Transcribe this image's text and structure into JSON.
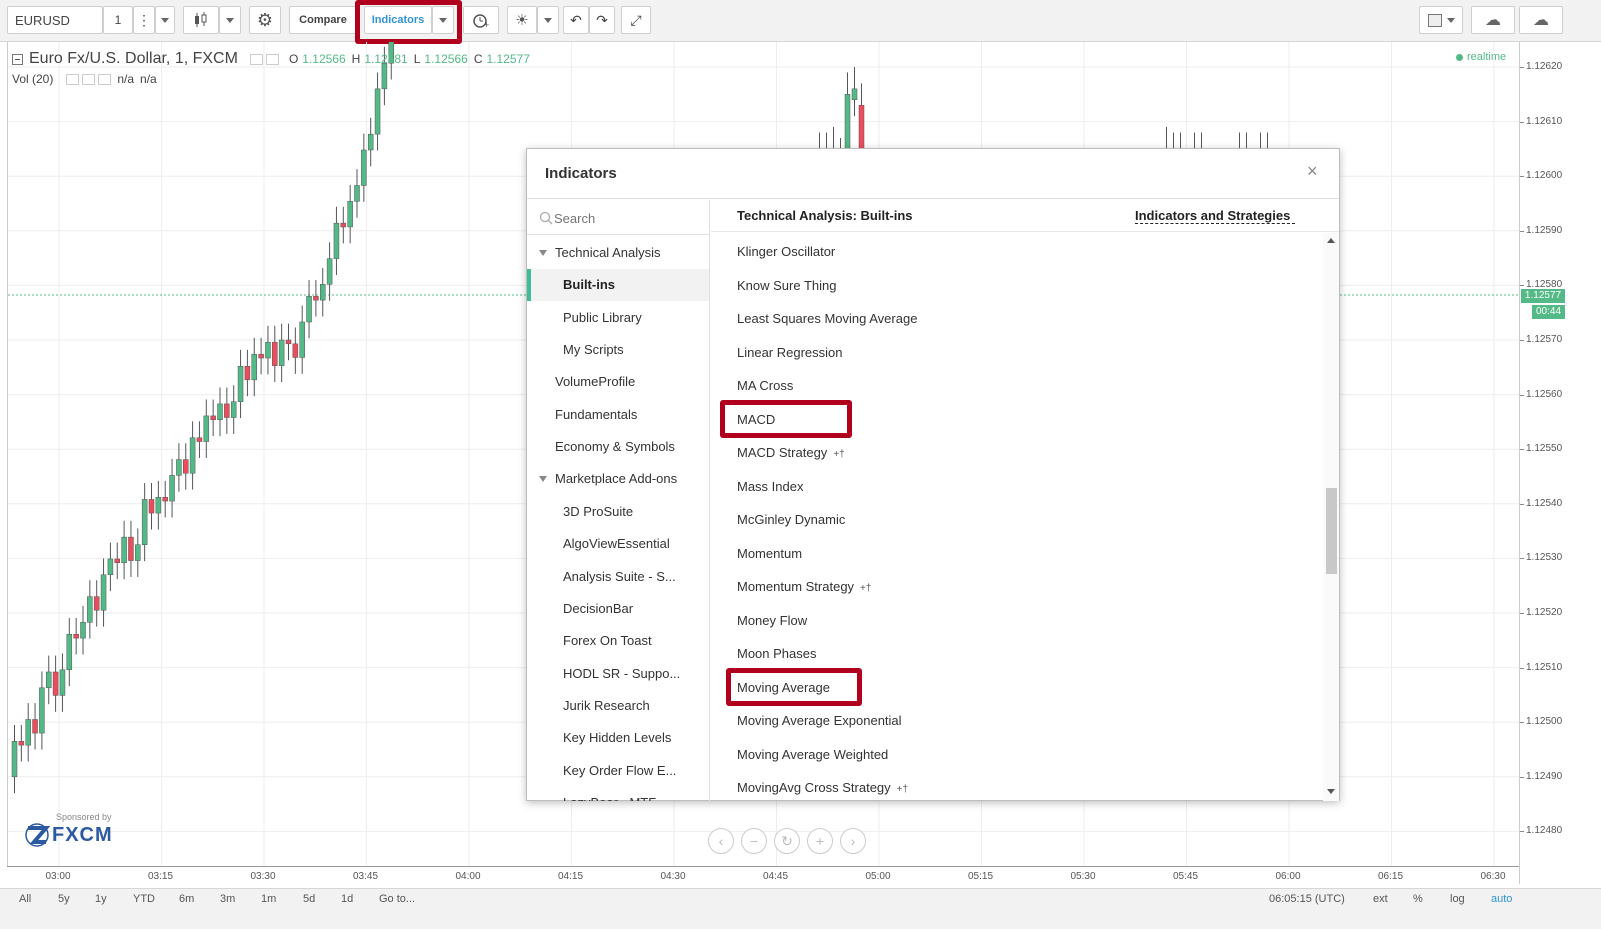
{
  "toolbar": {
    "symbol": "EURUSD",
    "interval": "1",
    "compare_label": "Compare",
    "indicators_label": "Indicators"
  },
  "legend": {
    "title": "Euro Fx/U.S. Dollar, 1, FXCM",
    "o_label": "O",
    "o_value": "1.12566",
    "h_label": "H",
    "h_value": "1.12581",
    "l_label": "L",
    "l_value": "1.12566",
    "c_label": "C",
    "c_value": "1.12577",
    "vol_label": "Vol (20)",
    "vol_value1": "n/a",
    "vol_value2": "n/a",
    "realtime": "realtime"
  },
  "sponsor": {
    "line1": "Sponsored by",
    "brand": "FXCM"
  },
  "price_axis": {
    "ticks": [
      "1.12620",
      "1.12610",
      "1.12600",
      "1.12590",
      "1.12580",
      "1.12570",
      "1.12560",
      "1.12550",
      "1.12540",
      "1.12530",
      "1.12520",
      "1.12510",
      "1.12500",
      "1.12490",
      "1.12480"
    ],
    "current_price": "1.12577",
    "countdown": "00:44"
  },
  "time_axis": {
    "ticks": [
      "03:00",
      "03:15",
      "03:30",
      "03:45",
      "04:00",
      "04:15",
      "04:30",
      "04:45",
      "05:00",
      "05:15",
      "05:30",
      "05:45",
      "06:00",
      "06:15",
      "06:30"
    ]
  },
  "bottom_bar": {
    "ranges": [
      "All",
      "5y",
      "1y",
      "YTD",
      "6m",
      "3m",
      "1m",
      "5d",
      "1d",
      "Go to..."
    ],
    "clock": "06:05:15 (UTC)",
    "ext": "ext",
    "percent": "%",
    "log": "log",
    "auto": "auto"
  },
  "dialog": {
    "title": "Indicators",
    "close": "×",
    "search_placeholder": "Search",
    "section_title": "Technical Analysis: Built-ins",
    "filter_label": "Indicators and Strategies",
    "categories": [
      {
        "label": "Technical Analysis",
        "group": true
      },
      {
        "label": "Built-ins",
        "sub": true,
        "selected": true
      },
      {
        "label": "Public Library",
        "sub": true
      },
      {
        "label": "My Scripts",
        "sub": true
      },
      {
        "label": "VolumeProfile"
      },
      {
        "label": "Fundamentals"
      },
      {
        "label": "Economy & Symbols"
      },
      {
        "label": "Marketplace Add-ons",
        "group": true
      },
      {
        "label": "3D ProSuite",
        "sub": true
      },
      {
        "label": "AlgoViewEssential",
        "sub": true
      },
      {
        "label": "Analysis Suite - S...",
        "sub": true
      },
      {
        "label": "DecisionBar",
        "sub": true
      },
      {
        "label": "Forex On Toast",
        "sub": true
      },
      {
        "label": "HODL SR - Suppo...",
        "sub": true
      },
      {
        "label": "Jurik Research",
        "sub": true
      },
      {
        "label": "Key Hidden Levels",
        "sub": true
      },
      {
        "label": "Key Order Flow E...",
        "sub": true
      },
      {
        "label": "LazyBear - MTF...",
        "sub": true
      }
    ],
    "indicators": [
      {
        "label": "Klinger Oscillator"
      },
      {
        "label": "Know Sure Thing"
      },
      {
        "label": "Least Squares Moving Average"
      },
      {
        "label": "Linear Regression"
      },
      {
        "label": "MA Cross"
      },
      {
        "label": "MACD",
        "highlight": true
      },
      {
        "label": "MACD Strategy",
        "strategy": true
      },
      {
        "label": "Mass Index"
      },
      {
        "label": "McGinley Dynamic"
      },
      {
        "label": "Momentum"
      },
      {
        "label": "Momentum Strategy",
        "strategy": true
      },
      {
        "label": "Money Flow"
      },
      {
        "label": "Moon Phases"
      },
      {
        "label": "Moving Average",
        "highlight": true
      },
      {
        "label": "Moving Average Exponential"
      },
      {
        "label": "Moving Average Weighted"
      },
      {
        "label": "MovingAvg Cross Strategy",
        "strategy": true
      }
    ],
    "strategy_mark": "+†"
  },
  "colors": {
    "up": "#53b987",
    "down": "#eb4d5c",
    "highlight_box": "#b0001e",
    "accent_blue": "#2e93d7",
    "selected_bar": "#3cbc98",
    "price_label_bg": "#53b987"
  }
}
